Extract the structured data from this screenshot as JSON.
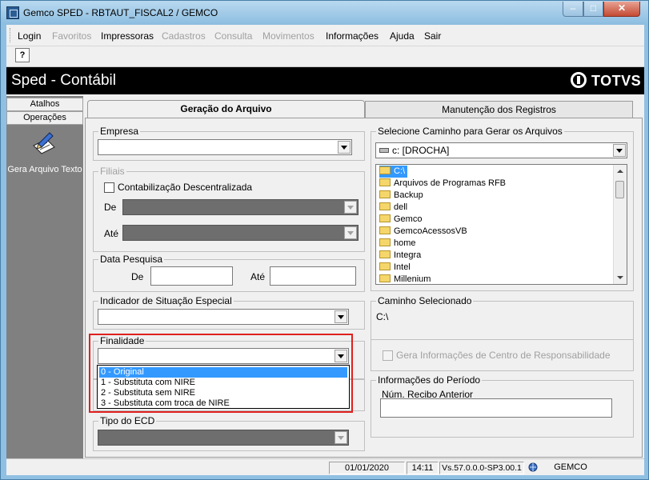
{
  "window": {
    "title": "Gemco SPED - RBTAUT_FISCAL2 / GEMCO",
    "minimize_icon": "minimize-icon",
    "maximize_icon": "maximize-icon",
    "close_icon": "close-icon"
  },
  "menu": {
    "items": [
      {
        "label": "Login",
        "enabled": true
      },
      {
        "label": "Favoritos",
        "enabled": false
      },
      {
        "label": "Impressoras",
        "enabled": true
      },
      {
        "label": "Cadastros",
        "enabled": false
      },
      {
        "label": "Consulta",
        "enabled": false
      },
      {
        "label": "Movimentos",
        "enabled": false
      },
      {
        "label": "Informações",
        "enabled": true
      },
      {
        "label": "Ajuda",
        "enabled": true
      },
      {
        "label": "Sair",
        "enabled": true
      }
    ]
  },
  "toolbar": {
    "help_icon": "help-icon",
    "help_glyph": "?"
  },
  "header": {
    "title": "Sped - Contábil",
    "logo": "TOTVS"
  },
  "sidebar": {
    "tabs": [
      "Atalhos",
      "Operações"
    ],
    "shortcut": {
      "label": "Gera Arquivo Texto",
      "icon": "pen-paper-icon"
    }
  },
  "tabs": [
    {
      "label": "Geração do Arquivo",
      "active": true
    },
    {
      "label": "Manutenção dos Registros",
      "active": false
    }
  ],
  "form": {
    "empresa": {
      "label": "Empresa",
      "value": ""
    },
    "filiais": {
      "label": "Filiais",
      "checkbox_label": "Contabilização Descentralizada",
      "checked": false,
      "de_label": "De",
      "ate_label": "Até"
    },
    "data_pesquisa": {
      "label": "Data Pesquisa",
      "de_label": "De",
      "ate_label": "Até",
      "de_value": "",
      "ate_value": ""
    },
    "indicador": {
      "label": "Indicador de Situação Especial",
      "value": ""
    },
    "finalidade": {
      "label": "Finalidade",
      "value": "",
      "options": [
        "0 - Original",
        "1 - Substituta com NIRE",
        "2 - Substituta sem NIRE",
        "3 - Substituta com troca de NIRE"
      ],
      "highlighted_index": 0
    },
    "tipo_ecd": {
      "label": "Tipo do ECD",
      "value": ""
    },
    "caminho": {
      "label": "Selecione Caminho  para Gerar os Arquivos",
      "drive": "c: [DROCHA]",
      "folders": [
        "C:\\",
        "Arquivos de Programas RFB",
        "Backup",
        "dell",
        "Gemco",
        "GemcoAcessosVB",
        "home",
        "Integra",
        "Intel",
        "Millenium"
      ],
      "selected_index": 0
    },
    "caminho_selecionado": {
      "label": "Caminho Selecionado",
      "value": "C:\\"
    },
    "centro_resp": {
      "label": "Gera Informações de Centro de Responsabilidade",
      "checked": false,
      "enabled": false
    },
    "periodo": {
      "label": "Informações  do  Período",
      "recibo_label": "Núm. Recibo Anterior",
      "recibo_value": ""
    }
  },
  "statusbar": {
    "date": "01/01/2020",
    "time": "14:11",
    "version": "Vs.57.0.0.0-SP3.00.1",
    "user": "GEMCO"
  },
  "colors": {
    "selection": "#3399ff",
    "highlight_border": "#e02020",
    "header_bg": "#000000"
  }
}
